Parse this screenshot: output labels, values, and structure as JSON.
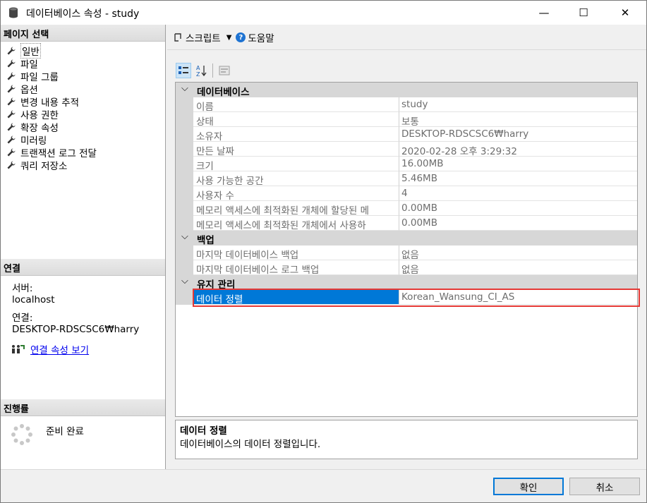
{
  "window": {
    "title": "데이터베이스 속성 - study",
    "minimize": "—",
    "maximize": "☐",
    "close": "✕"
  },
  "left": {
    "pages_header": "페이지 선택",
    "pages": [
      {
        "label": "일반",
        "icon": "wrench-icon",
        "selected": true
      },
      {
        "label": "파일",
        "icon": "wrench-icon"
      },
      {
        "label": "파일 그룹",
        "icon": "wrench-icon"
      },
      {
        "label": "옵션",
        "icon": "wrench-icon"
      },
      {
        "label": "변경 내용 추적",
        "icon": "wrench-icon"
      },
      {
        "label": "사용 권한",
        "icon": "wrench-icon"
      },
      {
        "label": "확장 속성",
        "icon": "wrench-icon"
      },
      {
        "label": "미러링",
        "icon": "wrench-icon"
      },
      {
        "label": "트랜잭션 로그 전달",
        "icon": "wrench-icon"
      },
      {
        "label": "쿼리 저장소",
        "icon": "wrench-icon"
      }
    ],
    "connection_header": "연결",
    "server_label": "서버:",
    "server_value": "localhost",
    "connection_label": "연결:",
    "connection_value": "DESKTOP-RDSCSC6₩harry",
    "view_connection_link": "연결 속성 보기",
    "progress_header": "진행률",
    "progress_status": "준비 완료"
  },
  "toolbar": {
    "script_label": "스크립트",
    "help_label": "도움말"
  },
  "grid": {
    "categories": [
      {
        "label": "데이터베이스",
        "rows": [
          {
            "name": "이름",
            "value": "study"
          },
          {
            "name": "상태",
            "value": "보통"
          },
          {
            "name": "소유자",
            "value": "DESKTOP-RDSCSC6₩harry"
          },
          {
            "name": "만든 날짜",
            "value": "2020-02-28 오후 3:29:32"
          },
          {
            "name": "크기",
            "value": "16.00MB"
          },
          {
            "name": "사용 가능한 공간",
            "value": "5.46MB"
          },
          {
            "name": "사용자 수",
            "value": "4"
          },
          {
            "name": "메모리 액세스에 최적화된 개체에 할당된 메",
            "value": "0.00MB"
          },
          {
            "name": "메모리 액세스에 최적화된 개체에서 사용하",
            "value": "0.00MB"
          }
        ]
      },
      {
        "label": "백업",
        "rows": [
          {
            "name": "마지막 데이터베이스 백업",
            "value": "없음"
          },
          {
            "name": "마지막 데이터베이스 로그 백업",
            "value": "없음"
          }
        ]
      },
      {
        "label": "유지 관리",
        "rows": [
          {
            "name": "데이터 정렬",
            "value": "Korean_Wansung_CI_AS",
            "selected": true
          }
        ]
      }
    ]
  },
  "description": {
    "title": "데이터 정렬",
    "text": "데이터베이스의 데이터 정렬입니다."
  },
  "buttons": {
    "ok": "확인",
    "cancel": "취소"
  },
  "colors": {
    "selection": "#0078d7",
    "highlight_border": "#e53935",
    "category_bg": "#d7d7d7"
  }
}
